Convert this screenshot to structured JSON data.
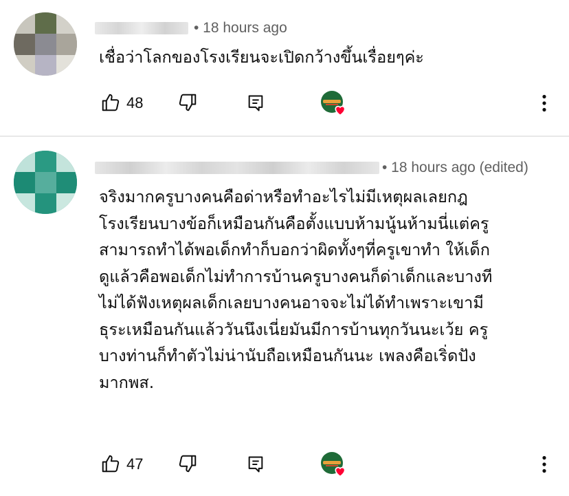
{
  "comments": [
    {
      "meta": "• 18 hours ago",
      "text_lines": [
        "เชื่อว่าโลกของโรงเรียนจะเปิดกว้างขึ้นเรื่อยๆค่ะ"
      ],
      "likes": "48"
    },
    {
      "meta": "• 18 hours ago (edited)",
      "text_lines": [
        "จริงมากครูบางคนคือด่าหรือทำอะไรไม่มีเหตุผลเลยกฎ",
        "โรงเรียนบางข้อก็เหมือนกันคือตั้งแบบห้ามนู้นห้ามนี่แต่ครู",
        "สามารถทำได้พอเด็กทำก็บอกว่าผิดทั้งๆที่ครูเขาทำ ให้เด็ก",
        "ดูแล้วคือพอเด็กไม่ทำการบ้านครูบางคนก็ด่าเด็กและบางที",
        "ไม่ได้ฟังเหตุผลเด็กเลยบางคนอาจจะไม่ได้ทำเพราะเขามี",
        "ธุระเหมือนกันแล้ววันนึงเนี่ยมันมีการบ้านทุกวันนะเว้ย ครู",
        "บางท่านก็ทำตัวไม่น่านับถือเหมือนกันนะ เพลงคือเริ่ดปัง",
        "มากพส."
      ],
      "likes": "47"
    }
  ],
  "icons": {
    "like": "thumbs-up-icon",
    "dislike": "thumbs-down-icon",
    "reply": "reply-comment-icon",
    "creator_heart": "creator-heart-icon",
    "more": "more-vertical-icon"
  },
  "colors": {
    "meta_text": "#606060",
    "heart": "#ff0033",
    "divider": "#e8e8e8",
    "avatar_2": "#1f8f7a"
  }
}
